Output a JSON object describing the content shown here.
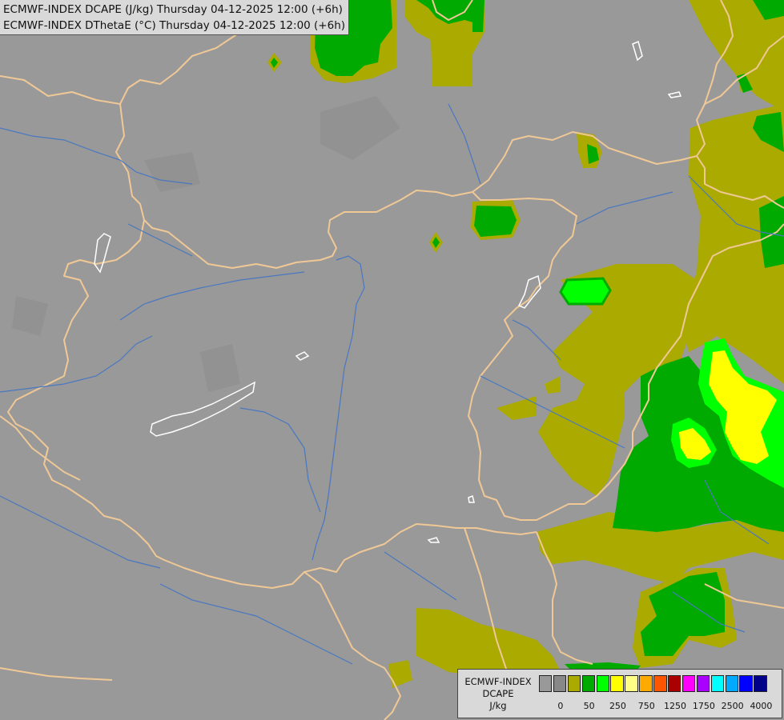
{
  "title": {
    "line1": "ECMWF-INDEX DCAPE (J/kg) Thursday 04-12-2025 12:00 (+6h)",
    "line2": "ECMWF-INDEX DThetaE (°C) Thursday 04-12-2025 12:00 (+6h)"
  },
  "legend": {
    "title1": "ECMWF-INDEX",
    "title2": "DCAPE",
    "unit": "J/kg",
    "colors": [
      "#999999",
      "#888888",
      "#aaaa00",
      "#00aa00",
      "#00ff00",
      "#ffff00",
      "#ffff88",
      "#ffaa00",
      "#ff5500",
      "#aa0000",
      "#ff00ff",
      "#aa00ff",
      "#00ffff",
      "#00aaff",
      "#0000ff",
      "#000088"
    ],
    "ticks": [
      "0",
      "50",
      "250",
      "750",
      "1250",
      "1750",
      "2500",
      "4000"
    ]
  },
  "map_colors": {
    "background": "#999999",
    "border": "#f0c896",
    "river": "#4a78c0",
    "lake": "#ffffff",
    "olive": "#aaaa00",
    "green": "#00aa00",
    "lime": "#00ff00",
    "yellow": "#ffff00"
  }
}
